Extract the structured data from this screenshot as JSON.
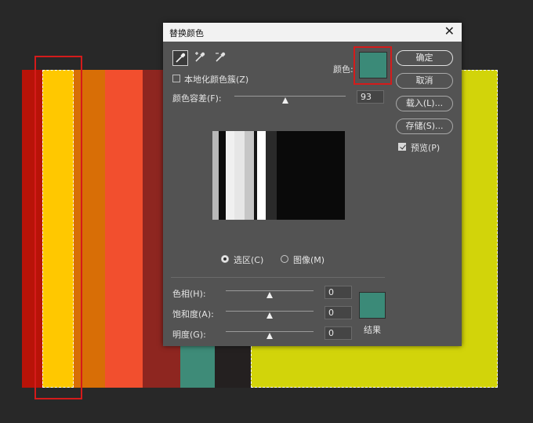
{
  "colors": {
    "canvas_bg": "#282828",
    "dialog_bg": "#535353",
    "result_color": "#3b8a78",
    "highlight_red": "#d41b1b",
    "strips": [
      "#b81308",
      "#ffc800",
      "#d86e06",
      "#f24f2e",
      "#8e2620",
      "#3a3a3a",
      "#3e8b78",
      "#242020",
      "#d2d40a"
    ]
  },
  "dialog": {
    "title": "替换颜色",
    "close_icon": "close-icon",
    "tools": [
      "eyedropper-icon",
      "eyedropper-plus-icon",
      "eyedropper-minus-icon"
    ],
    "localized_label": "本地化颜色簇(Z)",
    "localized_checked": false,
    "color_label": "颜色:",
    "fuzziness_label": "颜色容差(F):",
    "fuzziness_value": "93",
    "radio_selection": "选区(C)",
    "radio_image": "图像(M)",
    "selected_view": "选区(C)",
    "hue_label": "色相(H):",
    "hue_value": "0",
    "saturation_label": "饱和度(A):",
    "saturation_value": "0",
    "lightness_label": "明度(G):",
    "lightness_value": "0",
    "result_label": "结果",
    "buttons": {
      "ok": "确定",
      "cancel": "取消",
      "load": "载入(L)...",
      "save": "存储(S)..."
    },
    "preview_label": "预览(P)",
    "preview_checked": true
  }
}
